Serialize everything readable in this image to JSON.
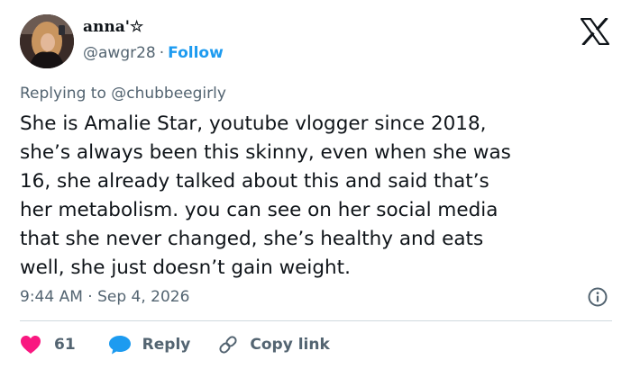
{
  "author": {
    "display_name": "anna'☆",
    "handle": "@awgr28",
    "separator": "·",
    "follow_label": "Follow"
  },
  "reply_context": {
    "prefix": "Replying to",
    "mention": "@chubbeegirly"
  },
  "tweet": {
    "text": "She is Amalie Star, youtube vlogger since 2018,\nshe’s always been this skinny, even when she was\n16, she already talked about this and said that’s\nher metabolism. you can see on her social media\nthat she never changed, she’s healthy and eats\nwell, she just doesn’t gain weight.",
    "timestamp": "9:44 AM · Sep 4, 2026"
  },
  "actions": {
    "like_count": "61",
    "reply_label": "Reply",
    "copy_link_label": "Copy link"
  },
  "icons": {
    "brand": "x-logo-icon",
    "info": "info-icon",
    "like": "heart-icon",
    "reply": "speech-bubble-icon",
    "copy_link": "link-icon"
  },
  "colors": {
    "accent": "#1d9bf0",
    "like": "#f91880",
    "muted_text": "#536471",
    "text": "#0f1419",
    "divider": "#cfd9de"
  }
}
